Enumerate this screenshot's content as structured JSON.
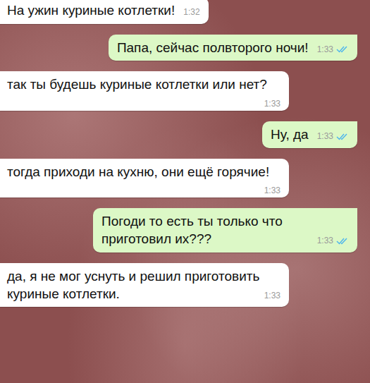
{
  "messages": [
    {
      "kind": "incoming",
      "text": "На ужин куриные котлетки!",
      "time": "1:32",
      "read": false
    },
    {
      "kind": "outgoing",
      "text": "Папа, сейчас полвторого ночи!",
      "time": "1:33",
      "read": true
    },
    {
      "kind": "incoming",
      "text": "так ты будешь куриные котлетки или нет?",
      "time": "1:33",
      "read": false
    },
    {
      "kind": "outgoing",
      "text": "Ну, да",
      "time": "1:33",
      "read": true
    },
    {
      "kind": "incoming",
      "text": "тогда приходи на кухню, они ещё горячие!",
      "time": "1:33",
      "read": false
    },
    {
      "kind": "outgoing",
      "text": "Погоди то есть ты только что приготовил их???",
      "time": "1:33",
      "read": true
    },
    {
      "kind": "incoming",
      "text": "да, я не мог уснуть и решил приготовить куриные котлетки.",
      "time": "1:33",
      "read": false
    }
  ]
}
